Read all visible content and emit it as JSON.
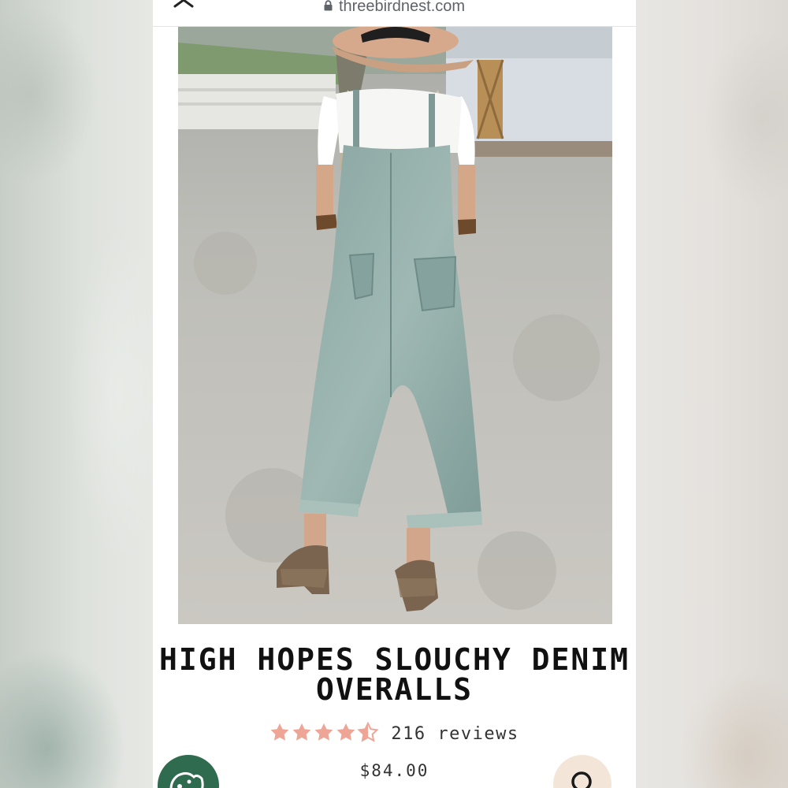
{
  "browser": {
    "url": "threebirdnest.com",
    "close_icon": "close-icon",
    "lock_icon": "lock-icon"
  },
  "product": {
    "image_alt": "Model wearing denim overalls, back view",
    "title": "HIGH HOPES SLOUCHY DENIM OVERALLS",
    "rating": 4.5,
    "rating_max": 5,
    "reviews": "216 reviews",
    "price": "$84.00"
  },
  "floating_buttons": {
    "left_icon": "cookie-icon",
    "right_icon": "search-icon"
  },
  "colors": {
    "star": "#eea596",
    "left_fab": "#2f6b4f",
    "right_fab": "#f3e6d8",
    "title": "#111111"
  }
}
